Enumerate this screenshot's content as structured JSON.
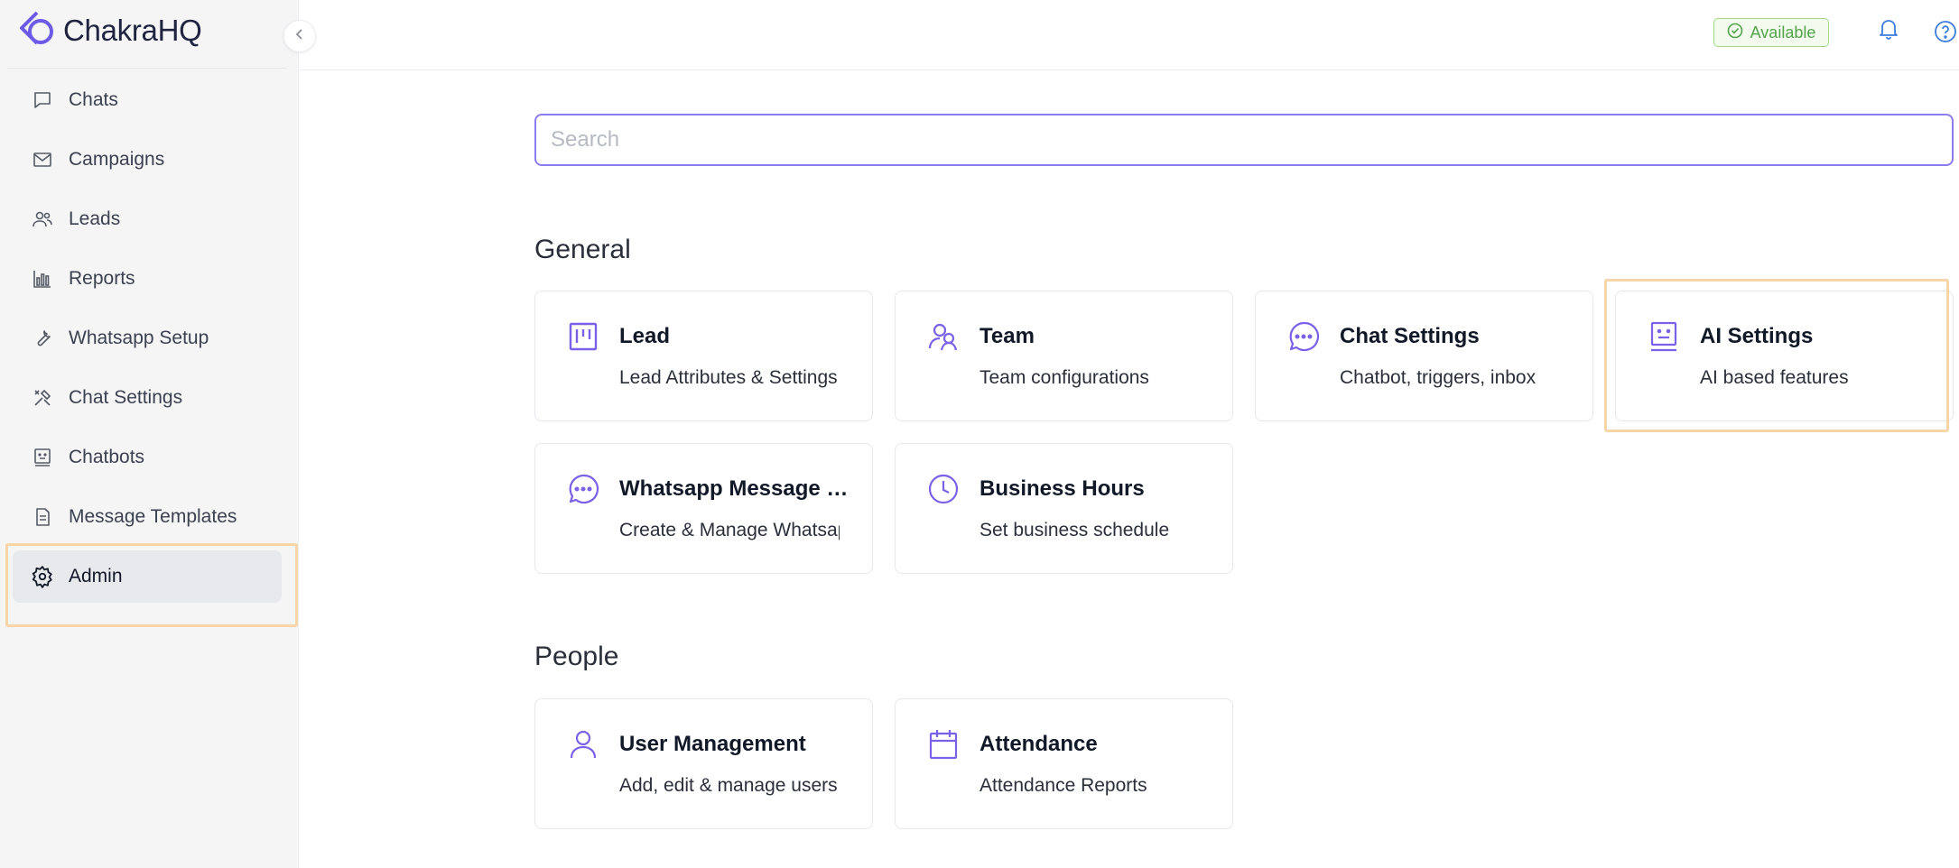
{
  "app": {
    "name": "ChakraHQ"
  },
  "sidebar": {
    "items": [
      {
        "label": "Chats",
        "icon": "chat-bubble-icon"
      },
      {
        "label": "Campaigns",
        "icon": "envelope-icon"
      },
      {
        "label": "Leads",
        "icon": "people-icon"
      },
      {
        "label": "Reports",
        "icon": "bar-chart-icon"
      },
      {
        "label": "Whatsapp Setup",
        "icon": "wrench-icon"
      },
      {
        "label": "Chat Settings",
        "icon": "tools-icon"
      },
      {
        "label": "Chatbots",
        "icon": "bot-icon"
      },
      {
        "label": "Message Templates",
        "icon": "document-icon"
      },
      {
        "label": "Admin",
        "icon": "gear-icon",
        "active": true
      }
    ]
  },
  "topbar": {
    "status": "Available",
    "status_color": "#52a34a"
  },
  "search": {
    "placeholder": "Search",
    "value": ""
  },
  "sections": [
    {
      "title": "General",
      "cards": [
        {
          "title": "Lead",
          "subtitle": "Lead Attributes & Settings",
          "icon": "kanban-icon"
        },
        {
          "title": "Team",
          "subtitle": "Team configurations",
          "icon": "team-icon"
        },
        {
          "title": "Chat Settings",
          "subtitle": "Chatbot, triggers, inbox",
          "icon": "chat-dots-icon"
        },
        {
          "title": "AI Settings",
          "subtitle": "AI based features",
          "icon": "ai-bot-icon"
        },
        {
          "title": "Whatsapp Message Templates",
          "subtitle": "Create & Manage Whatsapp templates",
          "icon": "chat-dots-icon"
        },
        {
          "title": "Business Hours",
          "subtitle": "Set business schedule",
          "icon": "clock-icon"
        }
      ]
    },
    {
      "title": "People",
      "cards": [
        {
          "title": "User Management",
          "subtitle": "Add, edit & manage users",
          "icon": "user-icon"
        },
        {
          "title": "Attendance",
          "subtitle": "Attendance Reports",
          "icon": "calendar-icon"
        }
      ]
    }
  ],
  "colors": {
    "accent": "#7b61e8",
    "highlight": "#f7d5a6"
  }
}
